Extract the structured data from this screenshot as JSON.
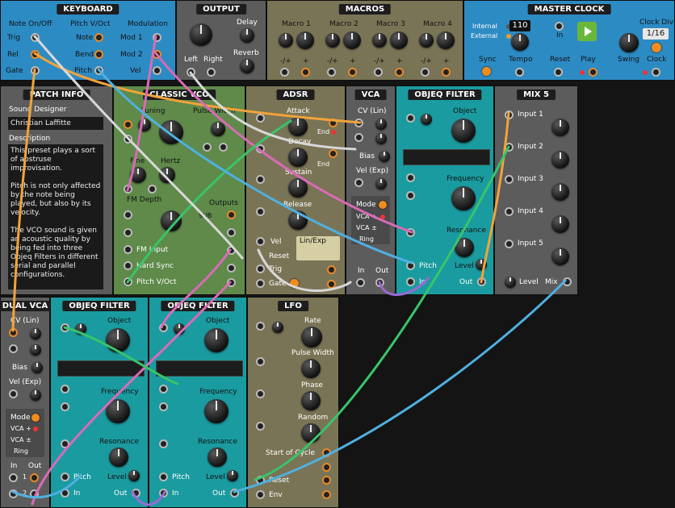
{
  "keyboard": {
    "title": "KEYBOARD",
    "col1": "Note On/Off",
    "col2": "Pitch V/Oct",
    "col3": "Modulation",
    "trig": "Trig",
    "rel": "Rel",
    "gate": "Gate",
    "note": "Note",
    "bend": "Bend",
    "pitch": "Pitch",
    "mod1": "Mod 1",
    "mod2": "Mod 2",
    "vel": "Vel"
  },
  "output": {
    "title": "OUTPUT",
    "delay": "Delay",
    "reverb": "Reverb",
    "left": "Left",
    "right": "Right"
  },
  "macros": {
    "title": "MACROS",
    "items": [
      "Macro 1",
      "Macro 2",
      "Macro 3",
      "Macro 4"
    ],
    "sub_a": "-/+",
    "sub_b": "+"
  },
  "master_clock": {
    "title": "MASTER CLOCK",
    "internal": "Internal",
    "external": "External",
    "sync": "Sync",
    "tempo_value": "110",
    "tempo": "Tempo",
    "in": "In",
    "reset": "Reset",
    "play": "Play",
    "swing": "Swing",
    "clock_div": "Clock Div",
    "clock_div_value": "1/16",
    "clock": "Clock"
  },
  "patch_info": {
    "title": "PATCH INFO",
    "sound_designer_label": "Sound Designer",
    "sound_designer": "Christian Laffitte",
    "description_label": "Description",
    "description": "This preset plays a sort of abstruse improvisation.\n\nPitch is not only affected by the note being played, but also by its velocity.\n\nThe VCO sound is given an acoustic quality by being fed into three Objeq Filters in different serial and parallel configurations."
  },
  "classic_vco": {
    "title": "CLASSIC VCO",
    "tuning": "Tuning",
    "pulse_width": "Pulse Width",
    "fine": "Fine",
    "hertz": "Hertz",
    "fm_depth": "FM Depth",
    "outputs": "Outputs",
    "sub": "SUB",
    "fm_input": "FM Input",
    "hard_sync": "Hard Sync",
    "pitch": "Pitch V/Oct"
  },
  "adsr": {
    "title": "ADSR",
    "attack": "Attack",
    "decay": "Decay",
    "sustain": "Sustain",
    "release": "Release",
    "end": "End",
    "vel": "Vel",
    "reset": "Reset",
    "trig": "Trig",
    "gate": "Gate",
    "lin_exp": "Lin/Exp"
  },
  "vca_top": {
    "title": "VCA",
    "cv_lin": "CV (Lin)",
    "bias": "Bias",
    "vel_exp": "Vel (Exp)",
    "mode": "Mode",
    "vca_plus": "VCA +",
    "vca_pm": "VCA ±",
    "ring": "Ring",
    "in": "In",
    "out": "Out"
  },
  "objeq_top": {
    "title": "OBJEQ FILTER",
    "object": "Object",
    "frequency": "Frequency",
    "resonance": "Resonance",
    "level": "Level",
    "pitch": "Pitch",
    "in": "In",
    "out": "Out"
  },
  "mix5": {
    "title": "MIX 5",
    "inputs": [
      "Input 1",
      "Input 2",
      "Input 3",
      "Input 4",
      "Input 5"
    ],
    "level": "Level",
    "mix": "Mix"
  },
  "dual_vca": {
    "title": "DUAL VCA",
    "cv_lin": "CV (Lin)",
    "bias": "Bias",
    "vel_exp": "Vel (Exp)",
    "mode": "Mode",
    "vca_plus": "VCA +",
    "vca_pm": "VCA ±",
    "ring": "Ring",
    "in": "In",
    "out": "Out",
    "one": "1",
    "two": "2"
  },
  "objeq_a": {
    "title": "OBJEQ FILTER",
    "object": "Object",
    "frequency": "Frequency",
    "resonance": "Resonance",
    "level": "Level",
    "pitch": "Pitch",
    "in": "In",
    "out": "Out"
  },
  "objeq_b": {
    "title": "OBJEQ FILTER",
    "object": "Object",
    "frequency": "Frequency",
    "resonance": "Resonance",
    "level": "Level",
    "pitch": "Pitch",
    "in": "In",
    "out": "Out"
  },
  "lfo": {
    "title": "LFO",
    "rate": "Rate",
    "pulse_width": "Pulse Width",
    "phase": "Phase",
    "random": "Random",
    "start_of_cycle": "Start of Cycle",
    "reset": "Reset",
    "env": "Env"
  },
  "colors": {
    "blue_panel": "#2d8bc4",
    "grey_panel": "#5c5c5c",
    "olive_panel": "#7a7456",
    "teal_panel": "#1a9ba0",
    "green_panel": "#5f8a4a",
    "cable_orange": "#f2a33a",
    "cable_pink": "#d86bb6",
    "cable_purple": "#9a6ad4",
    "cable_green": "#39c46a",
    "cable_blue": "#4fb0e0",
    "cable_white": "#d8d8d8"
  }
}
